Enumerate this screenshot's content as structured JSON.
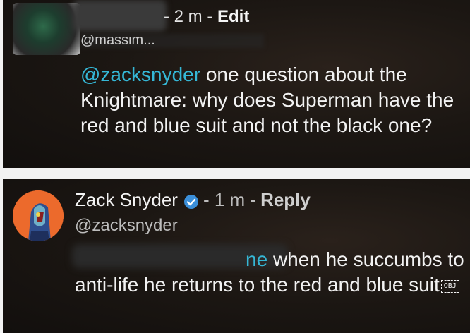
{
  "comment1": {
    "time": "- 2 m -",
    "edit_label": "Edit",
    "handle_fragment": "@massim...",
    "mention": "@zacksnyder",
    "text": " one question about the Knightmare: why does Superman have the red and blue suit and not the black one?"
  },
  "comment2": {
    "author_name": "Zack Snyder",
    "time": "- 1 m -",
    "reply_label": "Reply",
    "handle": "@zacksnyder",
    "mention_tail": "ne",
    "text": "when he succumbs to anti-life he returns to the red and blue suit",
    "obj_glyph": "OBJ"
  },
  "colors": {
    "mention": "#35b7d6",
    "verified": "#3b8fd9",
    "card_bg": "#1c1713"
  },
  "icons": {
    "verified": "verified-badge-icon"
  }
}
